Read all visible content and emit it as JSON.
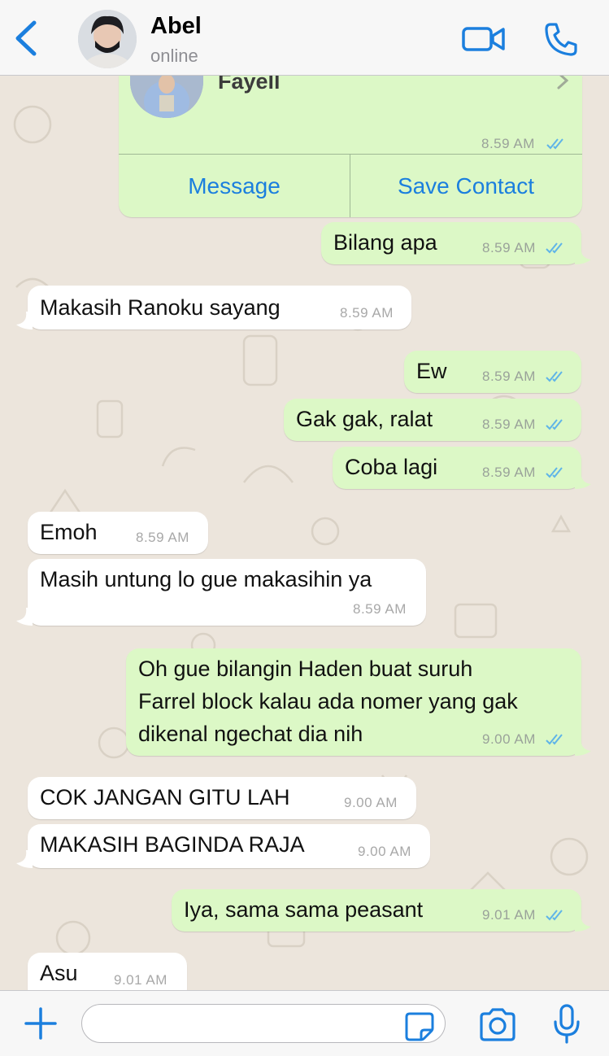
{
  "header": {
    "contact_name": "Abel",
    "status": "online"
  },
  "contact_card": {
    "name": "Fayell",
    "time": "8.59 AM",
    "message_button": "Message",
    "save_button": "Save Contact"
  },
  "messages": [
    {
      "dir": "out",
      "text": "Bilang apa",
      "time": "8.59 AM"
    },
    {
      "dir": "in",
      "text": "Makasih Ranoku sayang",
      "time": "8.59 AM"
    },
    {
      "dir": "out",
      "text": "Ew",
      "time": "8.59 AM"
    },
    {
      "dir": "out",
      "text": "Gak gak, ralat",
      "time": "8.59 AM"
    },
    {
      "dir": "out",
      "text": "Coba lagi",
      "time": "8.59 AM"
    },
    {
      "dir": "in",
      "text": "Emoh",
      "time": "8.59 AM"
    },
    {
      "dir": "in",
      "text": "Masih untung lo gue makasihin ya",
      "time": "8.59 AM"
    },
    {
      "dir": "out",
      "lines": [
        "Oh gue bilangin Haden buat suruh",
        "Farrel block kalau ada nomer yang gak",
        "dikenal ngechat dia nih"
      ],
      "time": "9.00 AM"
    },
    {
      "dir": "in",
      "text": "COK JANGAN GITU LAH",
      "time": "9.00 AM"
    },
    {
      "dir": "in",
      "text": "MAKASIH BAGINDA RAJA",
      "time": "9.00 AM"
    },
    {
      "dir": "out",
      "text": "Iya, sama sama peasant",
      "time": "9.01 AM"
    },
    {
      "dir": "in",
      "text": "Asu",
      "time": "9.01 AM"
    }
  ],
  "composer": {
    "placeholder": ""
  },
  "colors": {
    "accent": "#1b7fde",
    "outgoing_bubble": "#dcf8c6",
    "incoming_bubble": "#ffffff",
    "read_tick": "#5fb4e8",
    "chat_background": "#ece5dc"
  },
  "icons": [
    "back-chevron-icon",
    "video-call-icon",
    "phone-call-icon",
    "contact-chevron-icon",
    "plus-icon",
    "sticker-icon",
    "camera-icon",
    "microphone-icon",
    "double-tick-icon"
  ]
}
